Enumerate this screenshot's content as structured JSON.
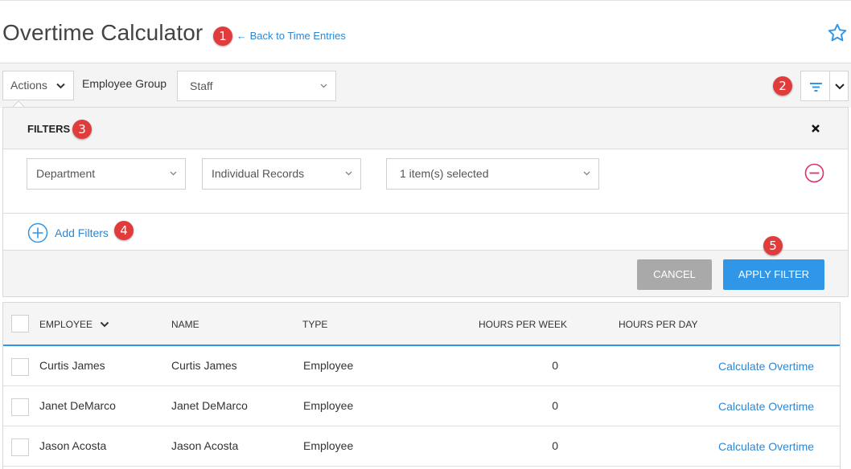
{
  "header": {
    "title": "Overtime Calculator",
    "back_link": "← Back to Time Entries",
    "favorite_icon": "star-icon"
  },
  "annotations": [
    "1",
    "2",
    "3",
    "4",
    "5"
  ],
  "toolbar": {
    "actions_label": "Actions",
    "group_label": "Employee Group",
    "group_value": "Staff",
    "filter_icon": "filter-icon"
  },
  "filters": {
    "title": "FILTERS",
    "field": "Department",
    "mode": "Individual Records",
    "selection": "1 item(s) selected",
    "add_label": "Add Filters",
    "cancel_label": "CANCEL",
    "apply_label": "APPLY FILTER"
  },
  "table": {
    "columns": [
      "EMPLOYEE",
      "NAME",
      "TYPE",
      "HOURS PER WEEK",
      "HOURS PER DAY"
    ],
    "rows": [
      {
        "employee": "Curtis James",
        "name": "Curtis James",
        "type": "Employee",
        "hours_week": "0",
        "action": "Calculate Overtime"
      },
      {
        "employee": "Janet DeMarco",
        "name": "Janet DeMarco",
        "type": "Employee",
        "hours_week": "0",
        "action": "Calculate Overtime"
      },
      {
        "employee": "Jason Acosta",
        "name": "Jason Acosta",
        "type": "Employee",
        "hours_week": "0",
        "action": "Calculate Overtime"
      }
    ]
  },
  "colors": {
    "accent": "#2f96e8",
    "link": "#2f86d1",
    "badge": "#e03c3c",
    "remove": "#d6336c"
  }
}
